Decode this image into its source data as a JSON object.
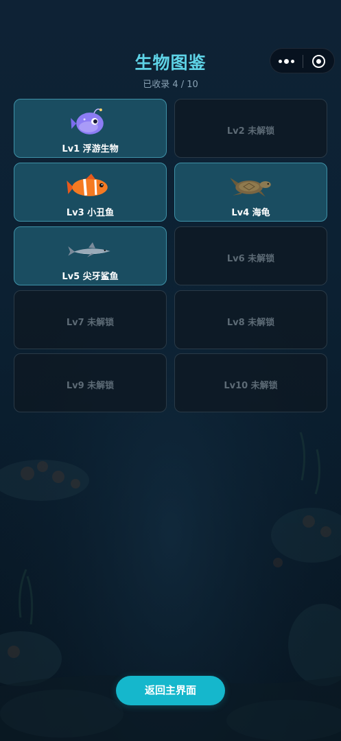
{
  "header": {
    "title": "生物图鉴",
    "subtitle": "已收录 4 / 10"
  },
  "capsule": {
    "more_icon": "more-dots-icon",
    "close_icon": "target-close-icon"
  },
  "collection": [
    {
      "label": "Lv1 浮游生物",
      "unlocked": true,
      "icon": "plankton-fish-icon"
    },
    {
      "label": "Lv2 未解锁",
      "unlocked": false
    },
    {
      "label": "Lv3 小丑鱼",
      "unlocked": true,
      "icon": "clownfish-icon"
    },
    {
      "label": "Lv4 海龟",
      "unlocked": true,
      "icon": "sea-turtle-icon"
    },
    {
      "label": "Lv5 尖牙鲨鱼",
      "unlocked": true,
      "icon": "shark-icon"
    },
    {
      "label": "Lv6 未解锁",
      "unlocked": false
    },
    {
      "label": "Lv7 未解锁",
      "unlocked": false
    },
    {
      "label": "Lv8 未解锁",
      "unlocked": false
    },
    {
      "label": "Lv9 未解锁",
      "unlocked": false
    },
    {
      "label": "Lv10 未解锁",
      "unlocked": false
    }
  ],
  "footer": {
    "back_label": "返回主界面"
  },
  "colors": {
    "accent": "#15b7cc",
    "title": "#5ed3e6",
    "card_unlocked": "#1a4d61",
    "card_locked": "#0e1821"
  }
}
